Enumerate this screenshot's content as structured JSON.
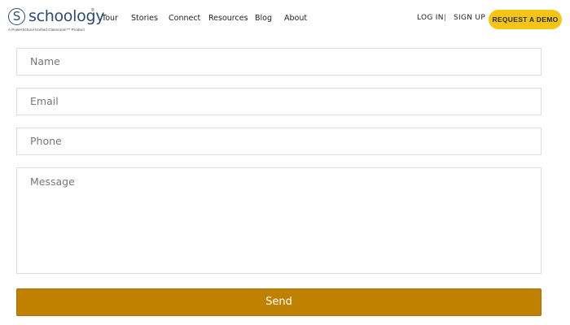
{
  "header": {
    "logo": {
      "mark": "S",
      "wordmark": "schoology",
      "trademark": "®",
      "tagline": "A PowerSchool Unified Classroom™ Product"
    },
    "nav": [
      {
        "label": "Tour"
      },
      {
        "label": "Stories"
      },
      {
        "label": "Connect"
      },
      {
        "label": "Resources"
      },
      {
        "label": "Blog"
      },
      {
        "label": "About"
      }
    ],
    "login_label": "LOG IN",
    "separator": "|",
    "signup_label": "SIGN UP",
    "demo_label": "REQUEST A DEMO"
  },
  "form": {
    "name_placeholder": "Name",
    "email_placeholder": "Email",
    "phone_placeholder": "Phone",
    "message_placeholder": "Message",
    "send_label": "Send"
  },
  "colors": {
    "brand_navy": "#2d4a73",
    "demo_yellow": "#f6c513",
    "send_gold": "#c08100"
  }
}
